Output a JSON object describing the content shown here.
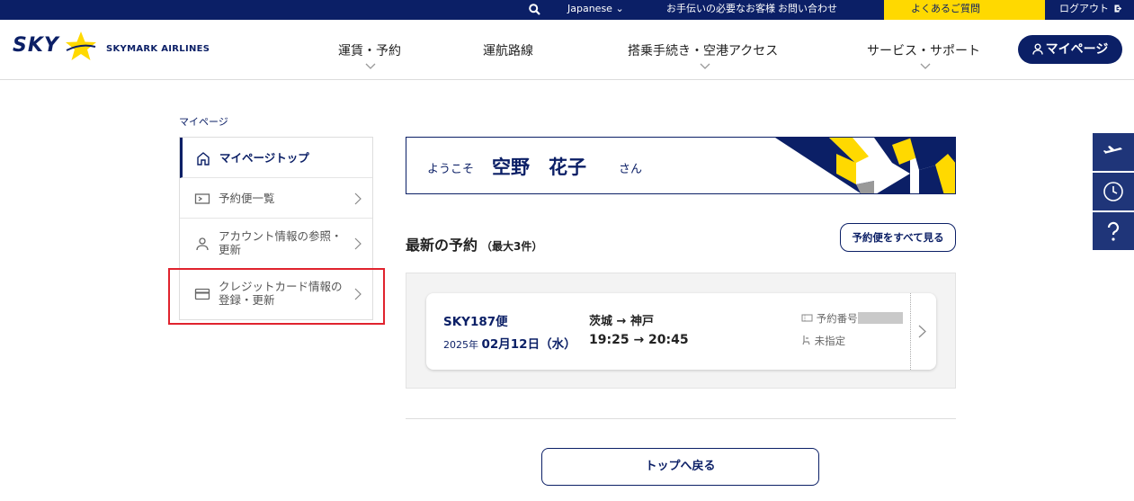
{
  "topbar": {
    "language": "Japanese ⌄",
    "help": "お手伝いの必要なお客様",
    "contact": "お問い合わせ",
    "faq": "よくあるご質問",
    "logout": "ログアウト"
  },
  "header": {
    "logo_sky": "SKY",
    "logo_airline": "SKYMARK AIRLINES",
    "nav": [
      "運賃・予約",
      "運航路線",
      "搭乗手続き・空港アクセス",
      "サービス・サポート"
    ],
    "mypage": "マイページ"
  },
  "breadcrumb": "マイページ",
  "sidebar": {
    "items": [
      {
        "label": "マイページトップ",
        "icon": "home-icon"
      },
      {
        "label": "予約便一覧",
        "icon": "ticket-icon"
      },
      {
        "label": "アカウント情報の参照・\n更新",
        "icon": "user-icon"
      },
      {
        "label": "クレジットカード情報の\n登録・更新",
        "icon": "credit-card-icon"
      }
    ]
  },
  "welcome": {
    "greeting": "ようこそ",
    "name": "空野　花子",
    "honorific": "さん"
  },
  "reservations": {
    "title": "最新の予約",
    "subtitle": "（最大3件）",
    "view_all": "予約便をすべて見る",
    "items": [
      {
        "flight": "SKY187便",
        "year": "2025年",
        "date": "02月12日（水）",
        "route": "茨城 → 神戸",
        "time": "19:25 → 20:45",
        "reservation_label": "予約番号",
        "seat": "未指定"
      }
    ]
  },
  "back_button": "トップへ戻る",
  "colors": {
    "navy": "#0b1f66",
    "yellow": "#ffd900",
    "highlight": "#e0232e"
  }
}
